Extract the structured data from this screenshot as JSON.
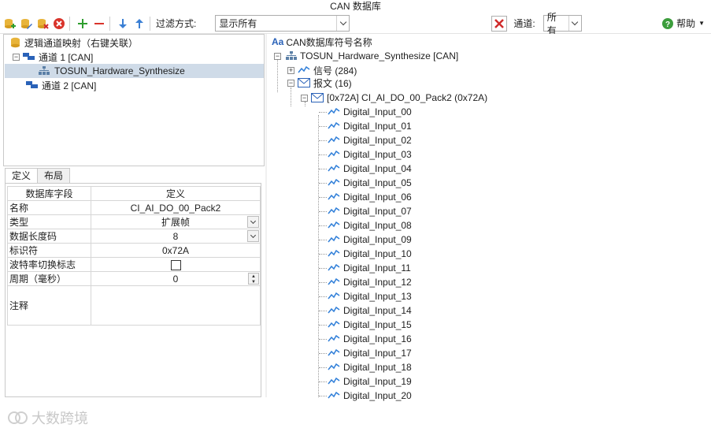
{
  "window": {
    "title": "CAN 数据库"
  },
  "toolbar": {
    "filter_label": "过滤方式:",
    "filter_value": "显示所有",
    "channel_label": "通道:",
    "channel_value": "所有",
    "help_label": "帮助"
  },
  "left_tree": {
    "root": "逻辑通道映射（右键关联）",
    "channel1": "通道 1 [CAN]",
    "db": "TOSUN_Hardware_Synthesize",
    "channel2": "通道 2 [CAN]"
  },
  "tabs": {
    "definition": "定义",
    "layout": "布局"
  },
  "properties": {
    "header_field": "数据库字段",
    "header_value": "定义",
    "rows": [
      {
        "key": "名称",
        "value": "CI_AI_DO_00_Pack2"
      },
      {
        "key": "类型",
        "value": "扩展帧"
      },
      {
        "key": "数据长度码",
        "value": "8"
      },
      {
        "key": "标识符",
        "value": "0x72A"
      },
      {
        "key": "波特率切换标志",
        "value": ""
      },
      {
        "key": "周期（毫秒）",
        "value": "0"
      },
      {
        "key": "注释",
        "value": ""
      }
    ]
  },
  "right_tree": {
    "header_icon": "Aa",
    "header": "CAN数据库符号名称",
    "db": "TOSUN_Hardware_Synthesize [CAN]",
    "signals": "信号 (284)",
    "messages": "报文 (16)",
    "message": "[0x72A] CI_AI_DO_00_Pack2 (0x72A)",
    "signal_items": [
      "Digital_Input_00",
      "Digital_Input_01",
      "Digital_Input_02",
      "Digital_Input_03",
      "Digital_Input_04",
      "Digital_Input_05",
      "Digital_Input_06",
      "Digital_Input_07",
      "Digital_Input_08",
      "Digital_Input_09",
      "Digital_Input_10",
      "Digital_Input_11",
      "Digital_Input_12",
      "Digital_Input_13",
      "Digital_Input_14",
      "Digital_Input_15",
      "Digital_Input_16",
      "Digital_Input_17",
      "Digital_Input_18",
      "Digital_Input_19",
      "Digital_Input_20"
    ]
  },
  "watermark": "大数跨境"
}
